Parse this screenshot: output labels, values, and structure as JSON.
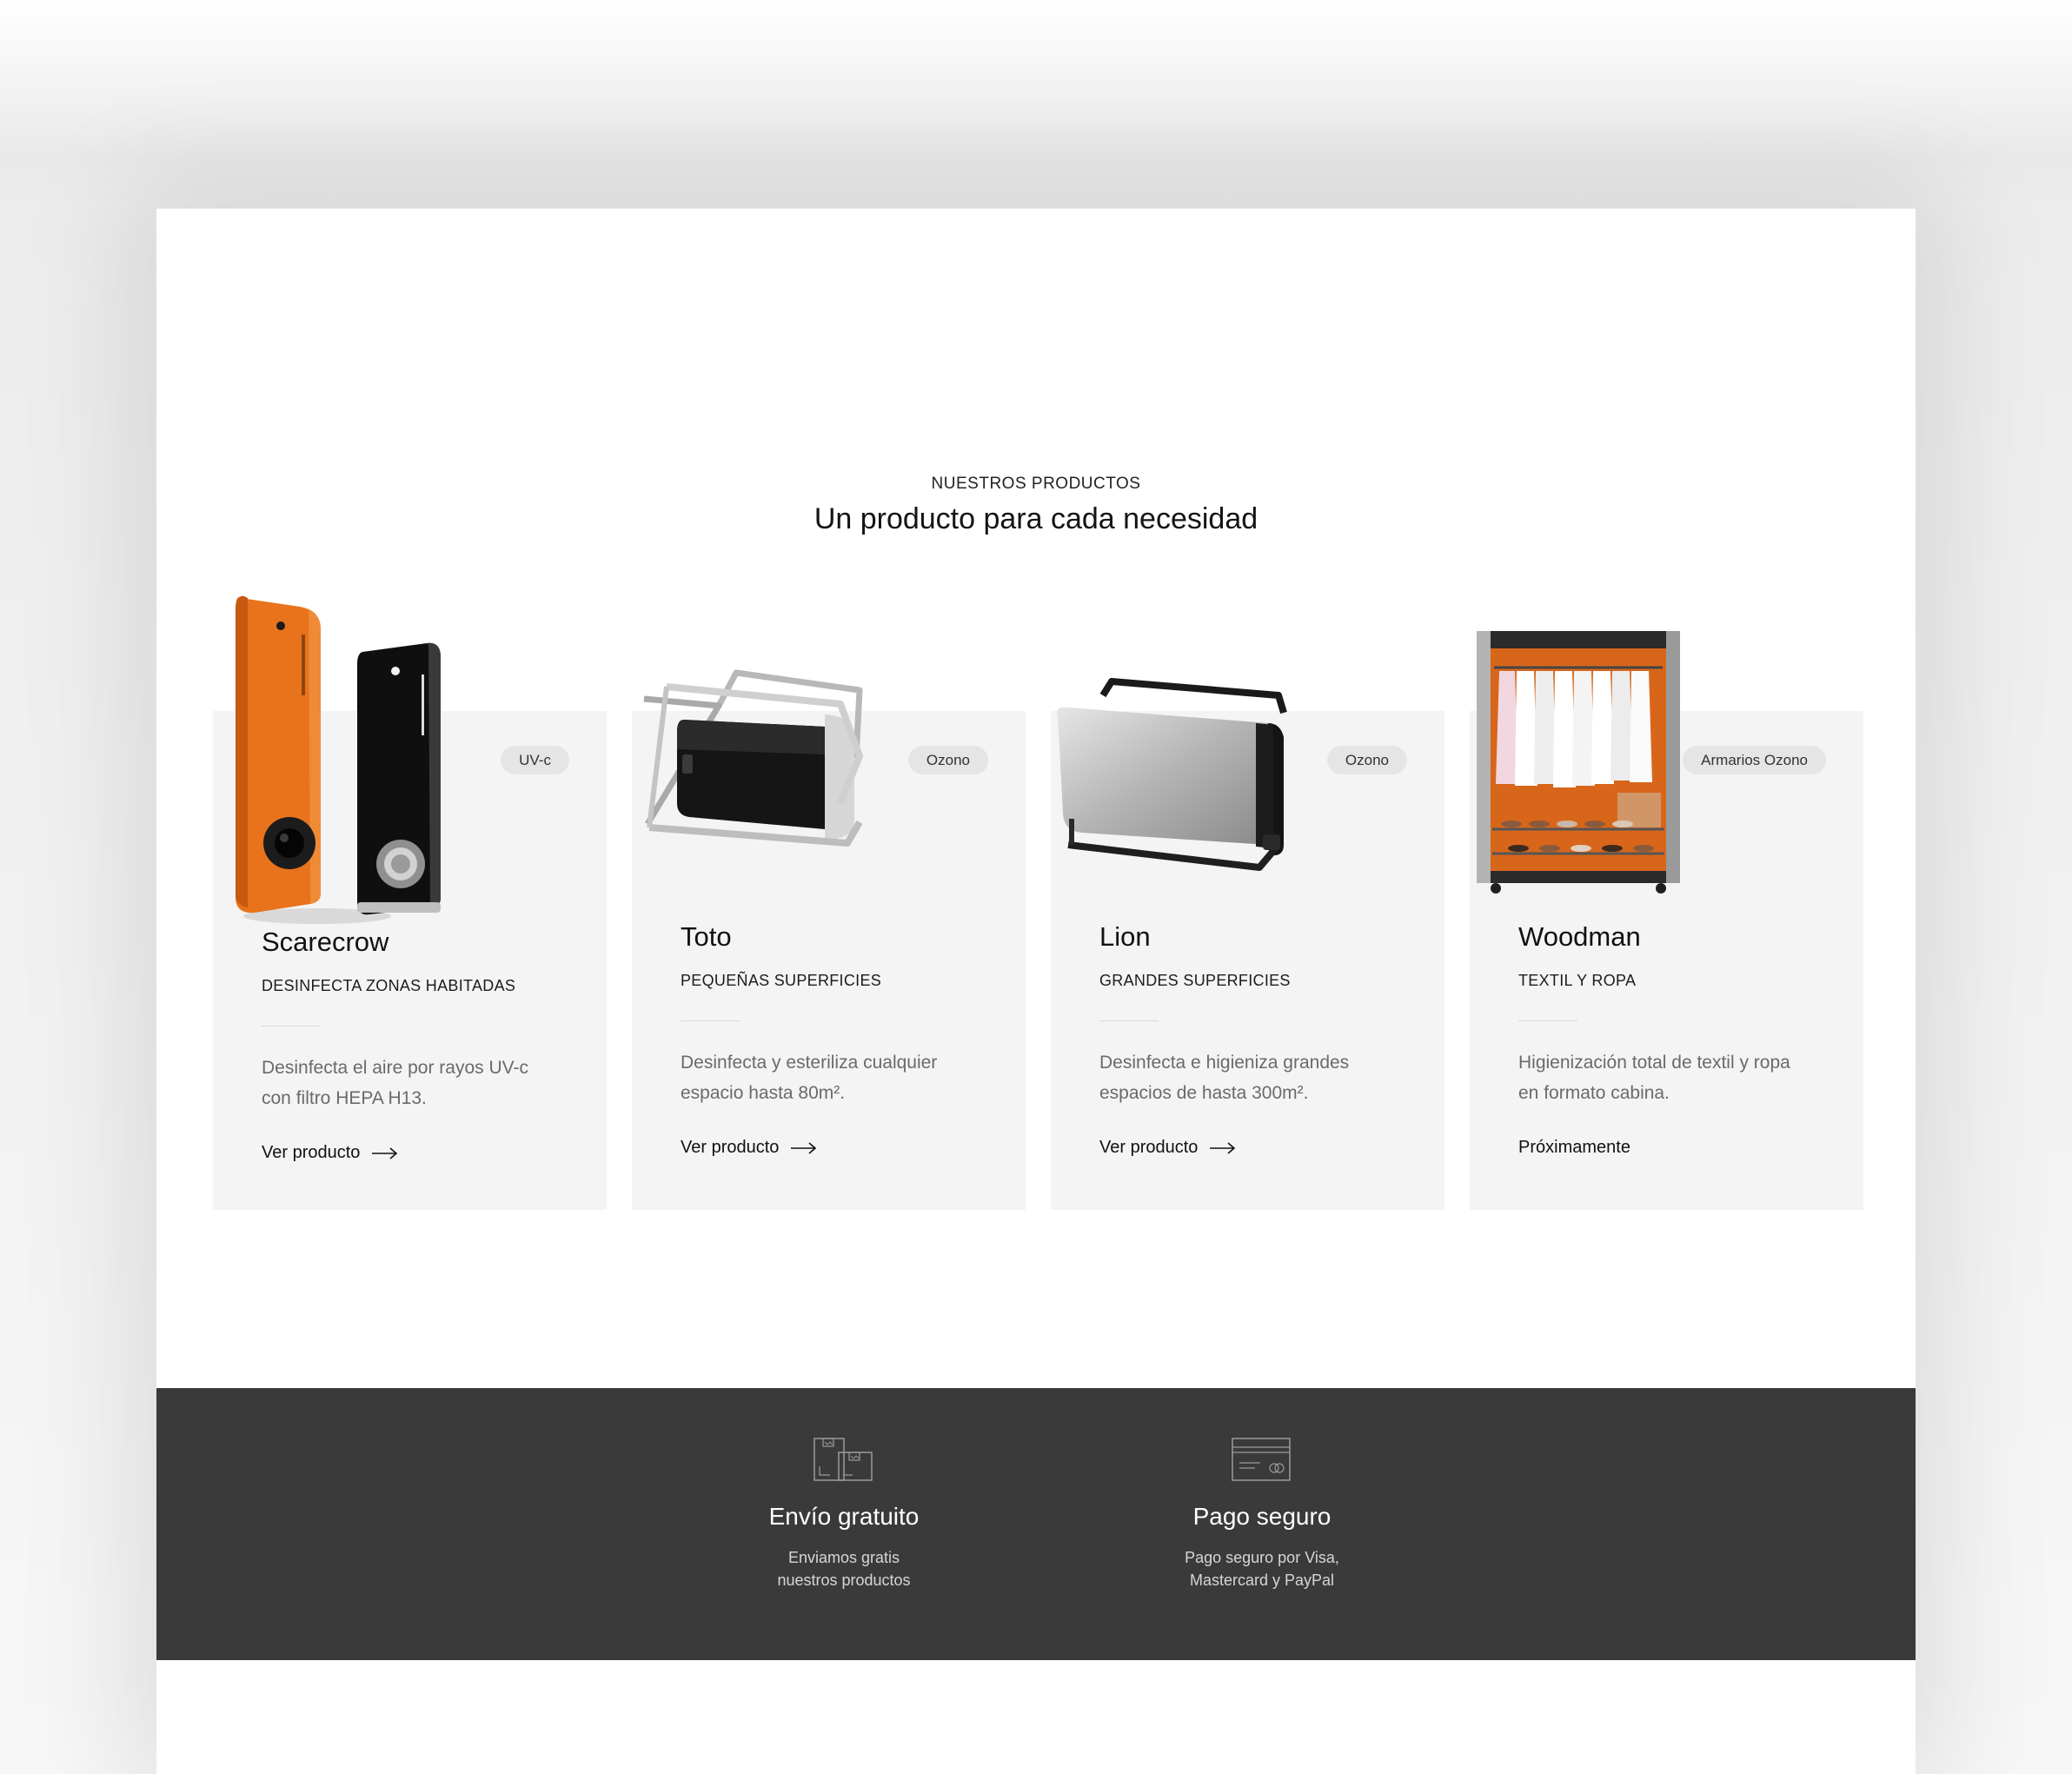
{
  "section": {
    "eyebrow": "NUESTROS PRODUCTOS",
    "title": "Un producto para cada necesidad"
  },
  "products": [
    {
      "name": "Scarecrow",
      "badge": "UV-c",
      "subtitle": "DESINFECTA ZONAS HABITADAS",
      "description_line1": "Desinfecta el aire por rayos UV-c",
      "description_line2": "con filtro HEPA H13.",
      "cta": "Ver producto",
      "image_icon": "uv-c-purifier-towers"
    },
    {
      "name": "Toto",
      "badge": "Ozono",
      "subtitle": "PEQUEÑAS SUPERFICIES",
      "description_line1": "Desinfecta y esteriliza cualquier",
      "description_line2": "espacio hasta 80m².",
      "cta": "Ver producto",
      "image_icon": "ozone-generator-small"
    },
    {
      "name": "Lion",
      "badge": "Ozono",
      "subtitle": "GRANDES SUPERFICIES",
      "description_line1": "Desinfecta e higieniza grandes",
      "description_line2": "espacios de hasta 300m².",
      "cta": "Ver producto",
      "image_icon": "ozone-generator-large"
    },
    {
      "name": "Woodman",
      "badge": "Armarios Ozono",
      "subtitle": "TEXTIL Y ROPA",
      "description_line1": "Higienización total de textil y ropa",
      "description_line2": "en formato cabina.",
      "cta": "Próximamente",
      "image_icon": "ozone-wardrobe-cabinet"
    }
  ],
  "features": [
    {
      "title": "Envío gratuito",
      "text_line1": "Enviamos gratis",
      "text_line2": "nuestros productos",
      "icon": "shipping-boxes-icon"
    },
    {
      "title": "Pago seguro",
      "text_line1": "Pago seguro por Visa,",
      "text_line2": "Mastercard y PayPal",
      "icon": "credit-card-icon"
    }
  ],
  "colors": {
    "accent_orange": "#e8731c",
    "card_background": "#f4f4f4",
    "badge_background": "#e5e5e5",
    "footer_background": "#3a3a3a"
  }
}
